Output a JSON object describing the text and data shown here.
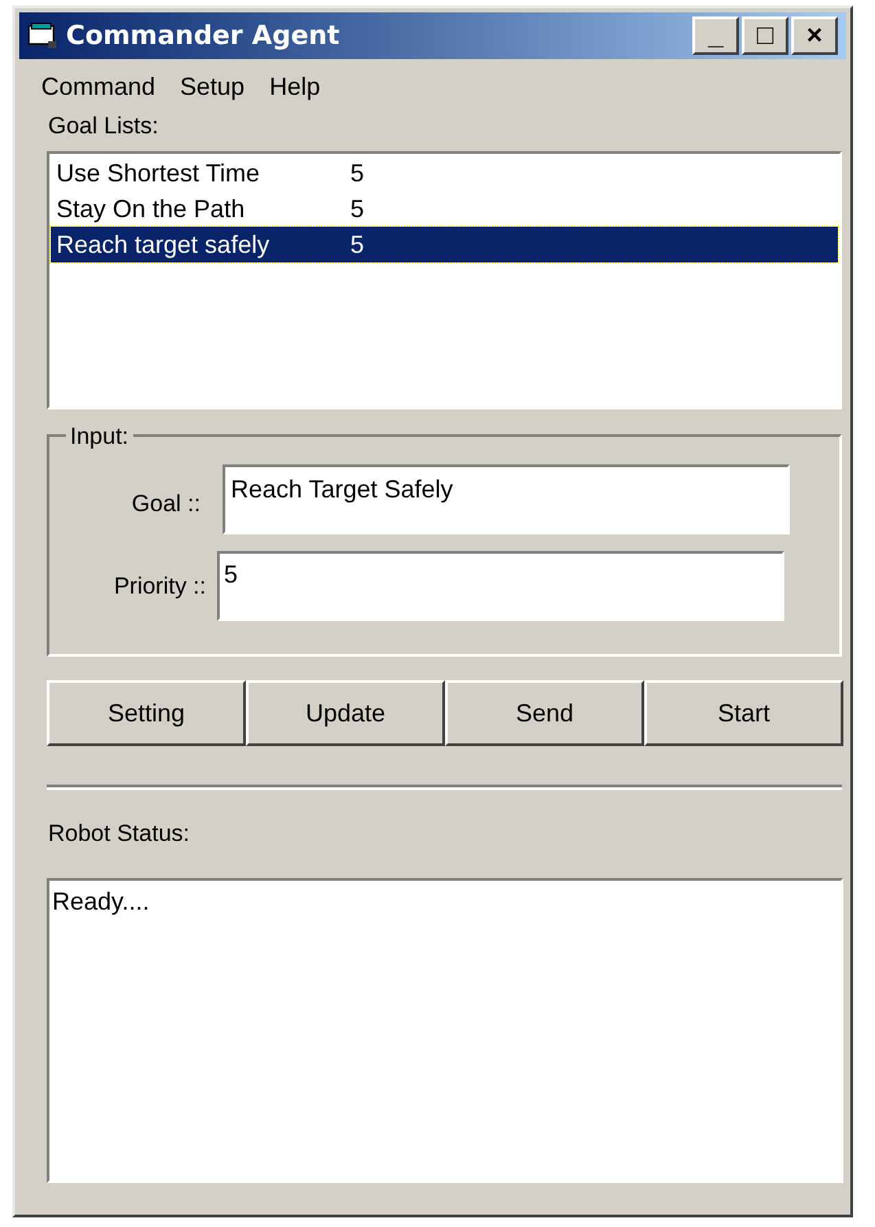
{
  "window": {
    "title": "Commander Agent",
    "controls": [
      "_",
      "□",
      "×"
    ]
  },
  "menu": [
    "Command",
    "Setup",
    "Help"
  ],
  "goal_lists": {
    "label": "Goal Lists:",
    "items": [
      {
        "goal": "Use Shortest Time",
        "priority": "5",
        "selected": false
      },
      {
        "goal": "Stay On the Path",
        "priority": "5",
        "selected": false
      },
      {
        "goal": "Reach target safely",
        "priority": "5",
        "selected": true
      }
    ]
  },
  "input": {
    "legend": "Input:",
    "goal_label": "Goal ::",
    "goal_value": "Reach Target Safely",
    "priority_label": "Priority ::",
    "priority_value": "5"
  },
  "buttons": [
    "Setting",
    "Update",
    "Send",
    "Start"
  ],
  "robot_status": {
    "label": "Robot Status:",
    "text": "Ready...."
  }
}
